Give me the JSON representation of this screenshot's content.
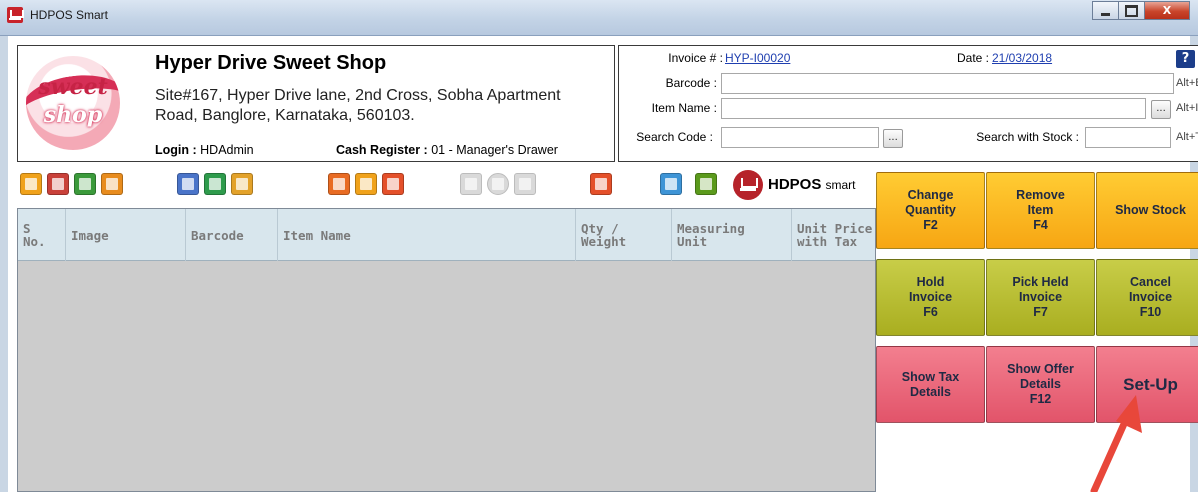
{
  "window": {
    "title": "HDPOS Smart",
    "controls": {
      "minimize": "",
      "maximize": "",
      "close": "X"
    }
  },
  "shop": {
    "name": "Hyper Drive Sweet Shop",
    "address_line1": "Site#167, Hyper Drive lane, 2nd Cross, Sobha Apartment",
    "address_line2": "Road, Banglore, Karnataka, 560103.",
    "login_label": "Login :",
    "login_value": "HDAdmin",
    "register_label": "Cash Register :",
    "register_value": "01 - Manager's Drawer",
    "logo_word1": "sweet",
    "logo_word2": "shop"
  },
  "invoice": {
    "invoice_label": "Invoice # :",
    "invoice_value": "HYP-I00020",
    "date_label": "Date :",
    "date_value": "21/03/2018",
    "help": "?",
    "barcode_label": "Barcode :",
    "barcode_shortcut": "Alt+B",
    "item_name_label": "Item Name :",
    "item_name_shortcut": "Alt+I",
    "search_code_label": "Search Code :",
    "search_stock_label": "Search with Stock :",
    "search_stock_shortcut": "Alt+T",
    "browse": "..."
  },
  "toolbar": {
    "brand_main": "HDPOS",
    "brand_suffix": "smart",
    "icons": [
      {
        "name": "calendar-icon",
        "color": "#f0a21b"
      },
      {
        "name": "report-icon",
        "color": "#c9413a"
      },
      {
        "name": "sales-report-icon",
        "color": "#3b9a3b"
      },
      {
        "name": "purchase-report-icon",
        "color": "#e88c1e"
      },
      {
        "name": "edit-invoice-icon",
        "color": "#4a74c9"
      },
      {
        "name": "cart-icon",
        "color": "#2e9b4c"
      },
      {
        "name": "customer-icon",
        "color": "#e3a22a"
      },
      {
        "name": "delivery-icon",
        "color": "#e86b23"
      },
      {
        "name": "notes-icon",
        "color": "#f0a21b"
      },
      {
        "name": "export-icon",
        "color": "#e4502a"
      },
      {
        "name": "checklist-icon",
        "color": "#d9d9d9"
      },
      {
        "name": "disabled-action-icon",
        "color": "#d9d9d9"
      },
      {
        "name": "cancel-icon",
        "color": "#d9d9d9"
      },
      {
        "name": "windows-icon",
        "color": "#e4502a"
      },
      {
        "name": "user-icon",
        "color": "#3e94d6"
      },
      {
        "name": "settings-icon",
        "color": "#5b9a1c"
      }
    ]
  },
  "grid": {
    "columns": [
      "S\nNo.",
      "Image",
      "Barcode",
      "Item Name",
      "Qty /\nWeight",
      "Measuring\nUnit",
      "Unit Price\nwith Tax"
    ],
    "rows": []
  },
  "buttons": [
    {
      "label": "Change\nQuantity\nF2",
      "style": "orange"
    },
    {
      "label": "Remove\nItem\nF4",
      "style": "orange"
    },
    {
      "label": "Show Stock",
      "style": "orange"
    },
    {
      "label": "Hold\nInvoice\nF6",
      "style": "olive"
    },
    {
      "label": "Pick Held\nInvoice\nF7",
      "style": "olive"
    },
    {
      "label": "Cancel\nInvoice\nF10",
      "style": "olive"
    },
    {
      "label": "Show Tax\nDetails",
      "style": "pink"
    },
    {
      "label": "Show Offer\nDetails\nF12",
      "style": "pink"
    },
    {
      "label": "Set-Up",
      "style": "pink"
    }
  ],
  "colors": {
    "orange": "#f7a613",
    "olive": "#a9ae20",
    "pink": "#e2546a",
    "annotation_arrow": "#e8473a",
    "link": "#1f3fb0"
  }
}
